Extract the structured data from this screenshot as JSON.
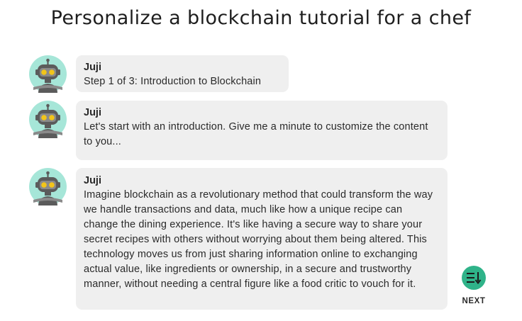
{
  "page": {
    "title": "Personalize a blockchain tutorial for a chef"
  },
  "messages": [
    {
      "sender": "Juji",
      "text": "Step 1 of 3: Introduction to Blockchain"
    },
    {
      "sender": "Juji",
      "text": "Let's start with an introduction. Give me a minute to customize the content to you..."
    },
    {
      "sender": "Juji",
      "text": "Imagine blockchain as a revolutionary method that could transform the way we handle transactions and data, much like how a unique recipe can change the dining experience. It's like having a secure way to share your secret recipes with others without worrying about them being altered. This technology moves us from just sharing information online to exchanging actual value, like ingredients or ownership, in a secure and trustworthy manner, without needing a central figure like a food critic to vouch for it."
    }
  ],
  "next": {
    "label": "NEXT",
    "icon": "list-sort-down-icon",
    "color": "#2fb389"
  },
  "colors": {
    "bubble": "#efefef",
    "avatar_bg": "#a6e6d8",
    "robot_body": "#5b5b5b",
    "robot_eyes": "#f2c51a"
  }
}
